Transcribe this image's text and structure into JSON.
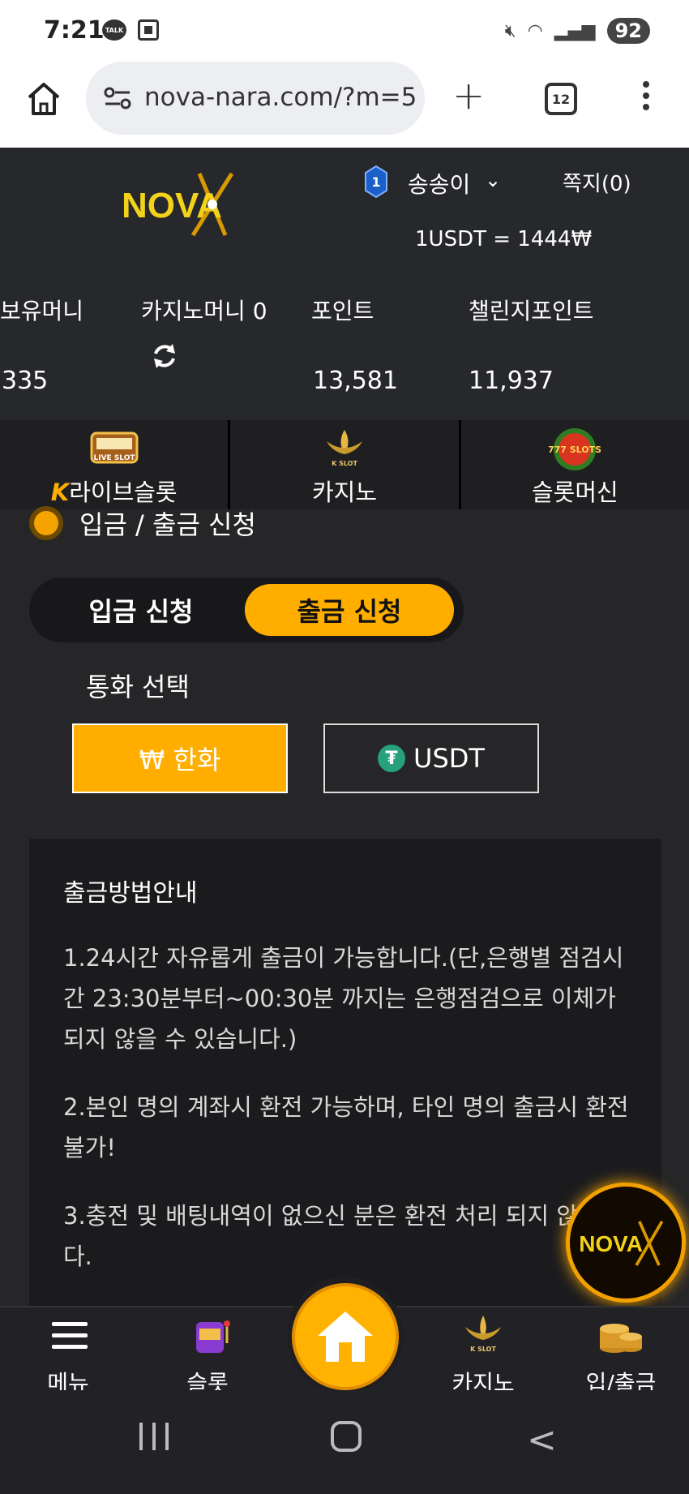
{
  "status_bar": {
    "time": "7:21",
    "talk_badge": "TALK",
    "battery": "92"
  },
  "browser": {
    "url": "nova-nara.com/?m=5",
    "tab_count": "12"
  },
  "header": {
    "logo_text": "NOVA",
    "level": "1",
    "username": "송송이",
    "messages": "쪽지(0)",
    "rate": "1USDT = 1444₩"
  },
  "balances": {
    "holding_label": "보유머니",
    "holding_value": "335",
    "casino_label": "카지노머니 0",
    "points_label": "포인트",
    "points_value": "13,581",
    "challenge_label": "챌린지포인트",
    "challenge_value": "11,937"
  },
  "categories": [
    {
      "label": "라이브슬롯",
      "icon_text": "LIVE SLOT"
    },
    {
      "label": "카지노",
      "icon_text": "K SLOT"
    },
    {
      "label": "슬롯머신",
      "icon_text": "777 SLOTS"
    }
  ],
  "main": {
    "section_title": "입금 / 출금 신청",
    "deposit_tab": "입금 신청",
    "withdraw_tab": "출금 신청",
    "currency_label": "통화 선택",
    "krw_button": "₩ 한화",
    "usdt_button": "USDT",
    "guide_title": "출금방법안내",
    "guide_1": "1.24시간 자유롭게 출금이 가능합니다.(단,은행별 점검시간 23:30분부터~00:30분 까지는 은행점검으로 이체가 되지 않을 수 있습니다.)",
    "guide_2": "2.본인 명의 계좌시 환전 가능하며, 타인 명의 출금시 환전 불가!",
    "guide_3": "3.충전 및 배팅내역이 없으신 분은 환전 처리 되지 않습니다."
  },
  "bottom_nav": {
    "menu": "메뉴",
    "slot": "슬롯",
    "casino": "카지노",
    "bank": "입/출금"
  },
  "colors": {
    "accent": "#ffae00",
    "background": "#262628",
    "header": "#27282b"
  }
}
